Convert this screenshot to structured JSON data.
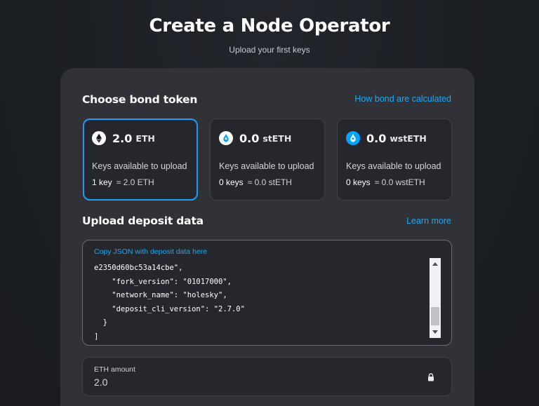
{
  "header": {
    "title": "Create a Node Operator",
    "subtitle": "Upload your first keys"
  },
  "bond": {
    "title": "Choose bond token",
    "link": "How bond are calculated",
    "tokens": [
      {
        "amount": "2.0",
        "symbol": "ETH",
        "label": "Keys available to upload",
        "keys": "1 key",
        "approx": "≈ 2.0 ETH",
        "icon": "eth-icon",
        "selected": true
      },
      {
        "amount": "0.0",
        "symbol": "stETH",
        "label": "Keys available to upload",
        "keys": "0 keys",
        "approx": "≈ 0.0 stETH",
        "icon": "steth-icon",
        "selected": false
      },
      {
        "amount": "0.0",
        "symbol": "wstETH",
        "label": "Keys available to upload",
        "keys": "0 keys",
        "approx": "≈ 0.0 wstETH",
        "icon": "wsteth-icon",
        "selected": false
      }
    ]
  },
  "deposit": {
    "title": "Upload deposit data",
    "link": "Learn more",
    "hint": "Copy JSON with deposit data here",
    "content": "e2350d60bc53a14cbe\",\n    \"fork_version\": \"01017000\",\n    \"network_name\": \"holesky\",\n    \"deposit_cli_version\": \"2.7.0\"\n  }\n]"
  },
  "eth_amount": {
    "label": "ETH amount",
    "value": "2.0",
    "icon": "lock-icon"
  },
  "colors": {
    "accent": "#1ca7f5",
    "card_bg": "#313238",
    "selected_border": "#1d9ef0"
  }
}
